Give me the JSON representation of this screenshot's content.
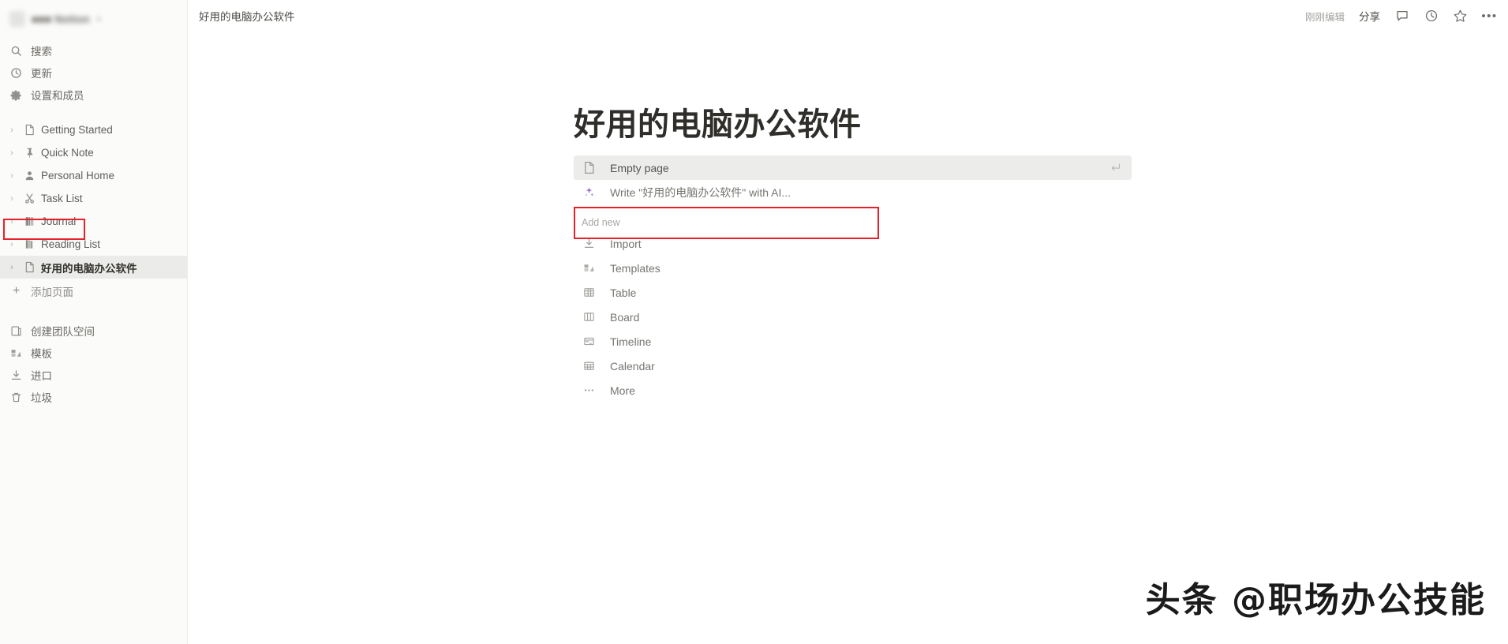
{
  "sidebar": {
    "workspace": {
      "name": "■■■ Notion",
      "caret": "∨",
      "redacted": true
    },
    "nav": [
      {
        "label": "搜索",
        "icon": "search-icon",
        "name": "sidebar-item-search"
      },
      {
        "label": "更新",
        "icon": "clock-icon",
        "name": "sidebar-item-updates"
      },
      {
        "label": "设置和成员",
        "icon": "gear-icon",
        "name": "sidebar-item-settings-members"
      }
    ],
    "pages": [
      {
        "label": "Getting Started",
        "icon": "document-icon",
        "selected": false
      },
      {
        "label": "Quick Note",
        "icon": "pin-icon",
        "selected": false
      },
      {
        "label": "Personal Home",
        "icon": "person-icon",
        "selected": false
      },
      {
        "label": "Task List",
        "icon": "scissors-icon",
        "selected": false
      },
      {
        "label": "Journal",
        "icon": "book-icon",
        "selected": false
      },
      {
        "label": "Reading List",
        "icon": "books-icon",
        "selected": false
      },
      {
        "label": "好用的电脑办公软件",
        "icon": "document-icon",
        "selected": true
      }
    ],
    "add_page": {
      "label": "添加页面",
      "icon": "plus-icon"
    },
    "bottom": [
      {
        "label": "创建团队空间",
        "icon": "teamspace-icon",
        "name": "sidebar-item-create-teamspace"
      },
      {
        "label": "模板",
        "icon": "templates-icon",
        "name": "sidebar-item-templates"
      },
      {
        "label": "进口",
        "icon": "import-icon",
        "name": "sidebar-item-import"
      },
      {
        "label": "垃圾",
        "icon": "trash-icon",
        "name": "sidebar-item-trash"
      }
    ]
  },
  "topbar": {
    "breadcrumb": "好用的电脑办公软件",
    "edited": "刚刚编辑",
    "share": "分享",
    "icons": [
      "comment-icon",
      "history-icon",
      "star-icon",
      "more-icon"
    ],
    "more": "•••"
  },
  "content": {
    "title": "好用的电脑办公软件",
    "empty_page": {
      "label": "Empty page",
      "icon": "document-icon",
      "enter_icon": "enter-return-icon"
    },
    "ai_write": {
      "label": "Write \"好用的电脑办公软件\" with AI...",
      "icon": "ai-sparkle-icon"
    },
    "add_new_label": "Add new",
    "add_new": [
      {
        "label": "Import",
        "icon": "import-icon"
      },
      {
        "label": "Templates",
        "icon": "templates-icon"
      },
      {
        "label": "Table",
        "icon": "table-icon"
      },
      {
        "label": "Board",
        "icon": "board-icon"
      },
      {
        "label": "Timeline",
        "icon": "timeline-icon"
      },
      {
        "label": "Calendar",
        "icon": "calendar-icon"
      },
      {
        "label": "More",
        "icon": "ellipsis-icon"
      }
    ]
  },
  "watermark": "头条 @职场办公技能",
  "annotations": {
    "highlight_color": "#e8202a",
    "boxes": [
      "add-page-button",
      "ai-write-row"
    ]
  }
}
